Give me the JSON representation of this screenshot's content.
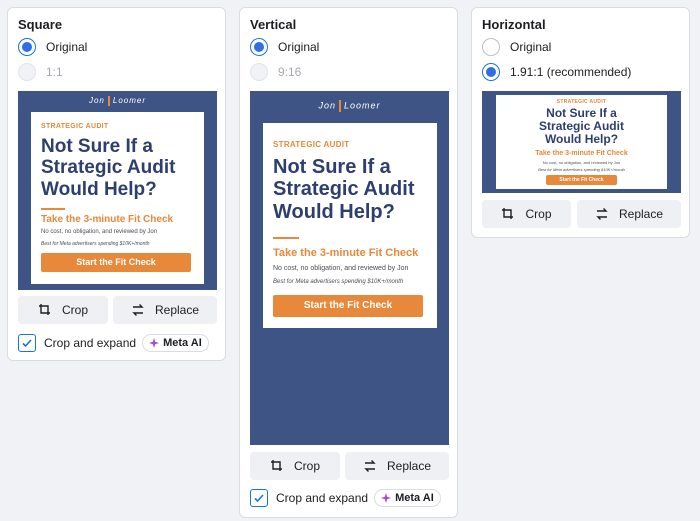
{
  "square": {
    "title": "Square",
    "options": [
      "Original",
      "1:1"
    ],
    "crop_label": "Crop",
    "replace_label": "Replace",
    "crop_expand_label": "Crop and expand",
    "meta_ai_label": "Meta AI"
  },
  "vertical": {
    "title": "Vertical",
    "options": [
      "Original",
      "9:16"
    ],
    "crop_label": "Crop",
    "replace_label": "Replace",
    "crop_expand_label": "Crop and expand",
    "meta_ai_label": "Meta AI"
  },
  "horizontal": {
    "title": "Horizontal",
    "options": [
      "Original",
      "1.91:1 (recommended)"
    ],
    "crop_label": "Crop",
    "replace_label": "Replace"
  },
  "ad": {
    "logo_left": "Jon",
    "logo_right": "Loomer",
    "eyebrow": "STRATEGIC AUDIT",
    "headline_1": "Not Sure If a",
    "headline_2": "Strategic Audit",
    "headline_3": "Would Help?",
    "fit_check": "Take the 3-minute Fit Check",
    "no_cost": "No cost, no obligation, and reviewed by Jon",
    "best_for": "Best for Meta advertisers spending $10K+/month",
    "cta": "Start the Fit Check"
  },
  "colors": {
    "accent_blue": "#2f6fe0",
    "ad_background": "#3d5485",
    "ad_orange": "#e8883a",
    "ad_headline": "#2d3f6e"
  }
}
